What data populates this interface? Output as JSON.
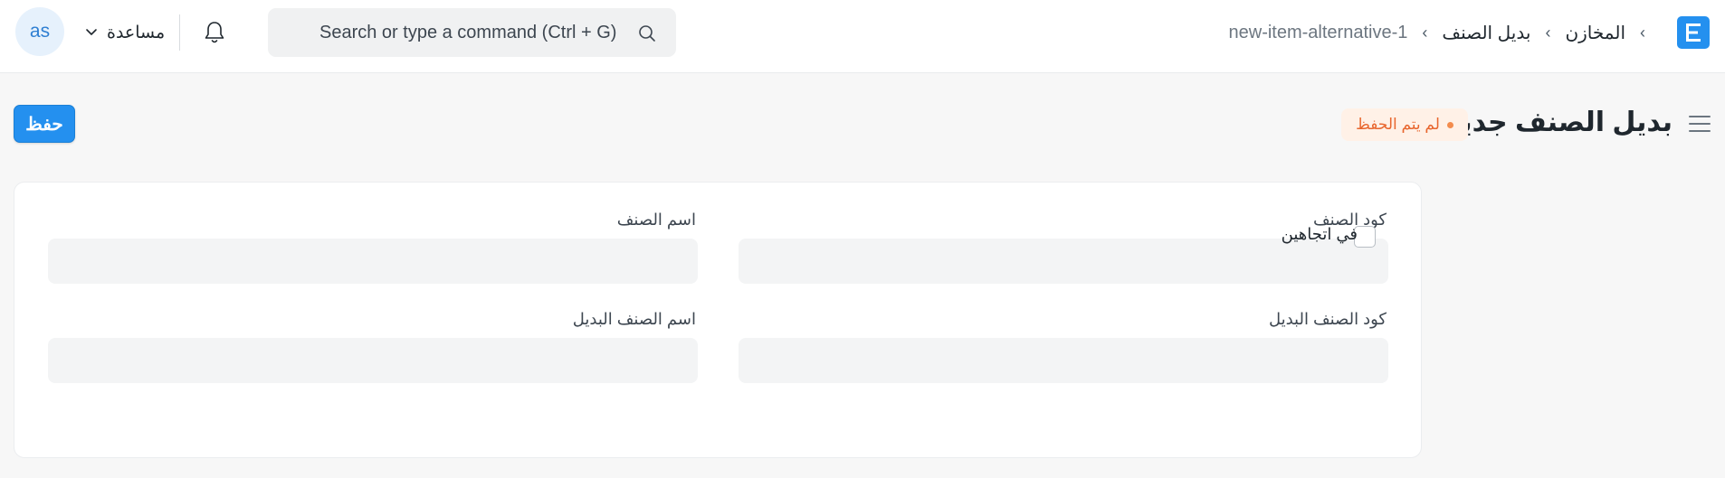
{
  "navbar": {
    "logo_letter": "E",
    "breadcrumb": [
      "المخازن",
      "بديل الصنف",
      "new-item-alternative-1"
    ],
    "search_placeholder": "Search or type a command (Ctrl + G)",
    "help_label": "مساعدة",
    "avatar_initials": "as"
  },
  "page": {
    "title": "بديل الصنف جديد",
    "status": "لم يتم الحفظ",
    "save_label": "حفظ"
  },
  "form": {
    "item_code_label": "كود الصنف",
    "item_code_value": "",
    "item_name_label": "اسم الصنف",
    "item_name_value": "",
    "alt_item_code_label": "كود الصنف البديل",
    "alt_item_code_value": "",
    "alt_item_name_label": "اسم الصنف البديل",
    "alt_item_name_value": "",
    "two_way_label": "في اتجاهين",
    "two_way_checked": false
  },
  "colors": {
    "brand": "#2490ef",
    "status_text": "#e8662e",
    "status_bg": "#fff1e7"
  }
}
